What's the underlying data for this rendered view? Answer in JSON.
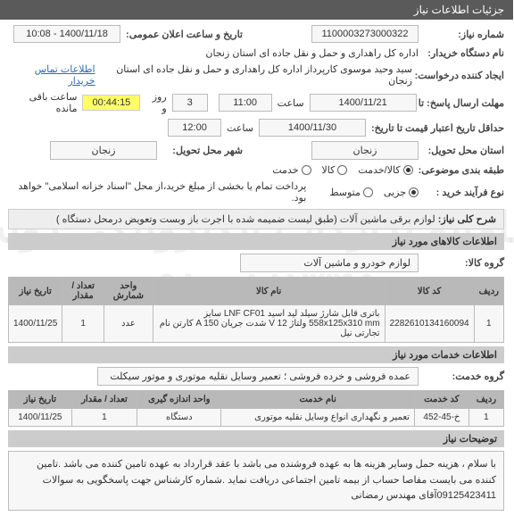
{
  "watermark_line1": "سامانه تدارکات الکترونیکی دولت",
  "watermark_line2": "۰۹۱۰-۸۸۲۳۴۵",
  "header": {
    "title": "جزئیات اطلاعات نیاز"
  },
  "info": {
    "need_no_label": "شماره نیاز:",
    "need_no": "1100003273000322",
    "pub_time_label": "تاریخ و ساعت اعلان عمومی:",
    "pub_time": "1400/11/18 - 10:08",
    "buyer_org_label": "نام دستگاه خریدار:",
    "buyer_org": "اداره کل راهداری و حمل و نقل جاده ای استان زنجان",
    "requester_label": "ایجاد کننده درخواست:",
    "requester": "سید وحید موسوی کارپرداز اداره کل راهداری و حمل و نقل جاده ای استان زنجان",
    "contact_link": "اطلاعات تماس خریدار",
    "reply_deadline_label": "مهلت ارسال پاسخ: تا",
    "reply_date": "1400/11/21",
    "reply_time_label": "ساعت",
    "reply_time": "11:00",
    "remaining_days": "3",
    "remaining_days_label": "روز و",
    "timer": "00:44:15",
    "timer_suffix": "ساعت باقی مانده",
    "credit_label": "حداقل تاریخ اعتبار قیمت تا تاریخ:",
    "credit_date": "1400/11/30",
    "credit_time_label": "ساعت",
    "credit_time": "12:00",
    "province_label": "استان محل تحویل:",
    "province": "زنجان",
    "city_label": "شهر محل تحویل:",
    "city": "زنجان",
    "subject_class_label": "طبقه بندی موضوعی:",
    "subject_opts": [
      "کالا/خدمت",
      "کالا",
      "خدمت"
    ],
    "process_label": "نوع فرآیند خرید :",
    "process_opts": [
      "جزیی",
      "متوسط"
    ],
    "process_note": "پرداخت تمام یا بخشی از مبلغ خرید،از محل \"اسناد خزانه اسلامی\" خواهد بود."
  },
  "need_title_label": "شرح کلی نیاز:",
  "need_title": "لوازم برقی ماشین آلات (طبق لیست ضمیمه شده با اجرت باز وبست وتعویض درمحل دستگاه )",
  "goods_section": "اطلاعات کالاهای مورد نیاز",
  "goods_group_label": "گروه کالا:",
  "goods_group": "لوازم خودرو و ماشین آلات",
  "goods_table": {
    "headers": [
      "ردیف",
      "کد کالا",
      "نام کالا",
      "واحد شمارش",
      "تعداد / مقدار",
      "تاریخ نیاز"
    ],
    "rows": [
      [
        "1",
        "2282610134160094",
        "باتری قابل شارژ سیلد لید اسید LNF CF01 سایز 558x125x310 mm ولتاژ V 12 شدت جریان A 150 کارتن نام تجارتی نیل",
        "عدد",
        "1",
        "1400/11/25"
      ]
    ]
  },
  "services_section": "اطلاعات خدمات مورد نیاز",
  "services_group_label": "گروه خدمت:",
  "services_group": "عمده فروشی و خرده فروشی ؛ تعمیر وسایل نقلیه موتوری و موتور سیکلت",
  "services_table": {
    "headers": [
      "ردیف",
      "کد خدمت",
      "نام خدمت",
      "واحد اندازه گیری",
      "تعداد / مقدار",
      "تاریخ نیاز"
    ],
    "rows": [
      [
        "1",
        "خ-45-452",
        "تعمیر و نگهداری انواع وسایل نقلیه موتوری",
        "دستگاه",
        "1",
        "1400/11/25"
      ]
    ]
  },
  "explanations_label": "توضیحات نیاز",
  "explanations": "با سلام ، هزینه حمل وسایر هزینه ها به عهده فروشنده می باشد با عقد قرارداد به عهده تامین کننده می باشد .تامین کننده می بایست مفاصا حساب از بیمه تامین اجتماعی دریافت نماید .شماره کارشناس جهت پاسخگویی به سوالات 09125423411آقای مهندس رمضانی"
}
